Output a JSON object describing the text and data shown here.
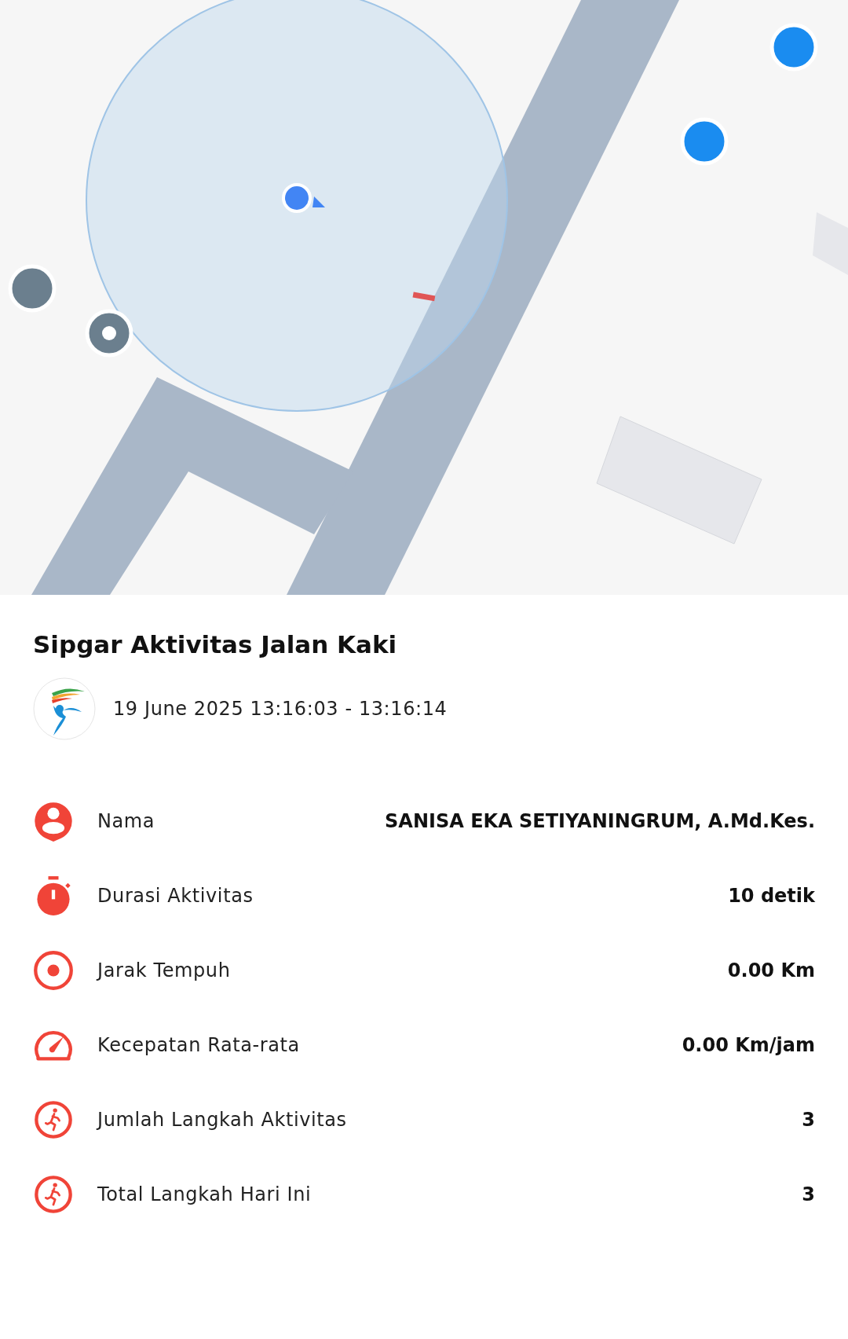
{
  "title": "Sipgar Aktivitas Jalan Kaki",
  "session": {
    "datetime": "19 June 2025 13:16:03 - 13:16:14"
  },
  "stats": [
    {
      "kind": "person",
      "label": "Nama",
      "value": "SANISA EKA SETIYANINGRUM, A.Md.Kes."
    },
    {
      "kind": "stopwatch",
      "label": "Durasi Aktivitas",
      "value": "10 detik"
    },
    {
      "kind": "target",
      "label": "Jarak Tempuh",
      "value": "0.00 Km"
    },
    {
      "kind": "gauge",
      "label": "Kecepatan Rata-rata",
      "value": "0.00 Km/jam"
    },
    {
      "kind": "runner",
      "label": "Jumlah Langkah Aktivitas",
      "value": "3"
    },
    {
      "kind": "runner",
      "label": "Total Langkah Hari Ini",
      "value": "3"
    }
  ]
}
